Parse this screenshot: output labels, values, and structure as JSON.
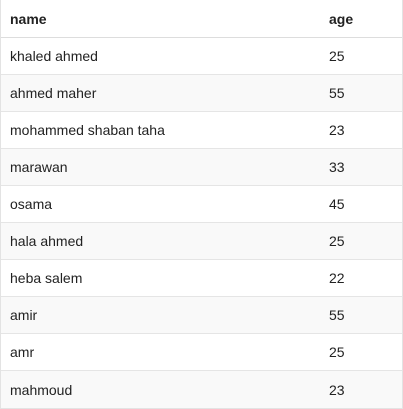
{
  "table": {
    "columns": {
      "name": "name",
      "age": "age"
    },
    "rows": [
      {
        "name": "khaled ahmed",
        "age": "25"
      },
      {
        "name": "ahmed maher",
        "age": "55"
      },
      {
        "name": "mohammed shaban taha",
        "age": "23"
      },
      {
        "name": "marawan",
        "age": "33"
      },
      {
        "name": "osama",
        "age": "45"
      },
      {
        "name": "hala ahmed",
        "age": "25"
      },
      {
        "name": "heba salem",
        "age": "22"
      },
      {
        "name": "amir",
        "age": "55"
      },
      {
        "name": "amr",
        "age": "25"
      },
      {
        "name": "mahmoud",
        "age": "23"
      }
    ]
  }
}
